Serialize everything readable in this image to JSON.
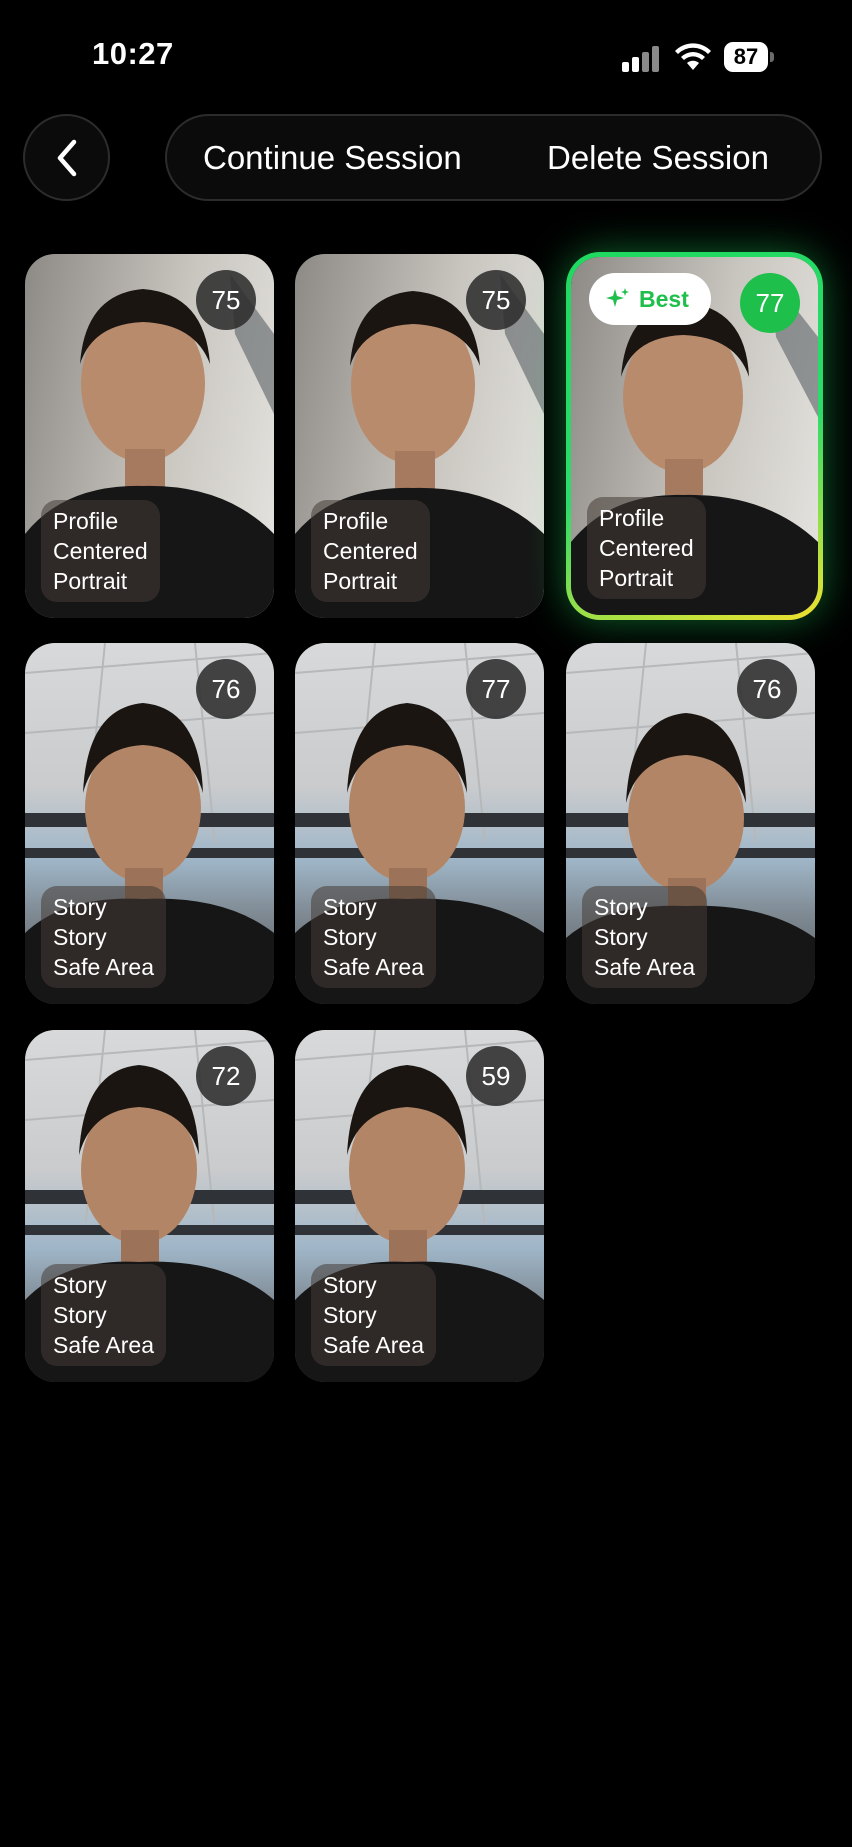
{
  "status_bar": {
    "time": "10:27",
    "battery": "87"
  },
  "header": {
    "continue_label": "Continue Session",
    "delete_label": "Delete Session"
  },
  "best_badge_label": "Best",
  "photos": [
    {
      "score": "75",
      "label": [
        "Profile",
        "Centered",
        "Portrait"
      ],
      "scene": "portrait"
    },
    {
      "score": "75",
      "label": [
        "Profile",
        "Centered",
        "Portrait"
      ],
      "scene": "portrait"
    },
    {
      "score": "77",
      "label": [
        "Profile",
        "Centered",
        "Portrait"
      ],
      "scene": "portrait",
      "best": true
    },
    {
      "score": "76",
      "label": [
        "Story",
        "Story",
        "Safe Area"
      ],
      "scene": "story"
    },
    {
      "score": "77",
      "label": [
        "Story",
        "Story",
        "Safe Area"
      ],
      "scene": "story"
    },
    {
      "score": "76",
      "label": [
        "Story",
        "Story",
        "Safe Area"
      ],
      "scene": "story"
    },
    {
      "score": "72",
      "label": [
        "Story",
        "Story",
        "Safe Area"
      ],
      "scene": "story"
    },
    {
      "score": "59",
      "label": [
        "Story",
        "Story",
        "Safe Area"
      ],
      "scene": "story"
    }
  ],
  "colors": {
    "accent": "#1fbf4b",
    "background": "#000000"
  }
}
